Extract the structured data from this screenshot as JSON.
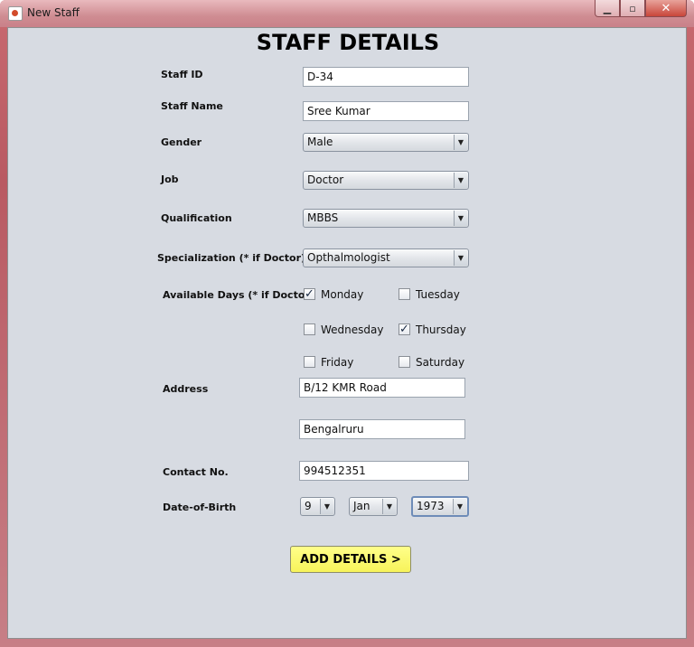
{
  "window": {
    "title": "New Staff",
    "minimize_glyph": "▁",
    "maximize_glyph": "▫",
    "close_glyph": "✕"
  },
  "form": {
    "heading": "STAFF DETAILS",
    "staff_id": {
      "label": "Staff ID",
      "value": "D-34"
    },
    "staff_name": {
      "label": "Staff Name",
      "value": "Sree Kumar"
    },
    "gender": {
      "label": "Gender",
      "value": "Male"
    },
    "job": {
      "label": "Job",
      "value": "Doctor"
    },
    "qualification": {
      "label": "Qualification",
      "value": "MBBS"
    },
    "specialization": {
      "label": "Specialization (* if Doctor)",
      "value": "Opthalmologist"
    },
    "available_days": {
      "label": "Available Days (* if Doctor)",
      "days": [
        {
          "name": "Monday",
          "checked": true
        },
        {
          "name": "Tuesday",
          "checked": false
        },
        {
          "name": "Wednesday",
          "checked": false
        },
        {
          "name": "Thursday",
          "checked": true
        },
        {
          "name": "Friday",
          "checked": false
        },
        {
          "name": "Saturday",
          "checked": false
        }
      ]
    },
    "address": {
      "label": "Address",
      "line1": "B/12 KMR Road",
      "line2": "Bengalruru"
    },
    "contact": {
      "label": "Contact No.",
      "value": "994512351"
    },
    "dob": {
      "label": "Date-of-Birth",
      "day": "9",
      "month": "Jan",
      "year": "1973"
    },
    "submit_label": "ADD DETAILS >"
  },
  "colors": {
    "window_frame": "#c86a70",
    "client_bg": "#d7dbe2",
    "submit_bg": "#f7f35a"
  },
  "icons": {
    "app": "java-app-icon",
    "combo_arrow": "▼",
    "check_mark": "✓"
  }
}
